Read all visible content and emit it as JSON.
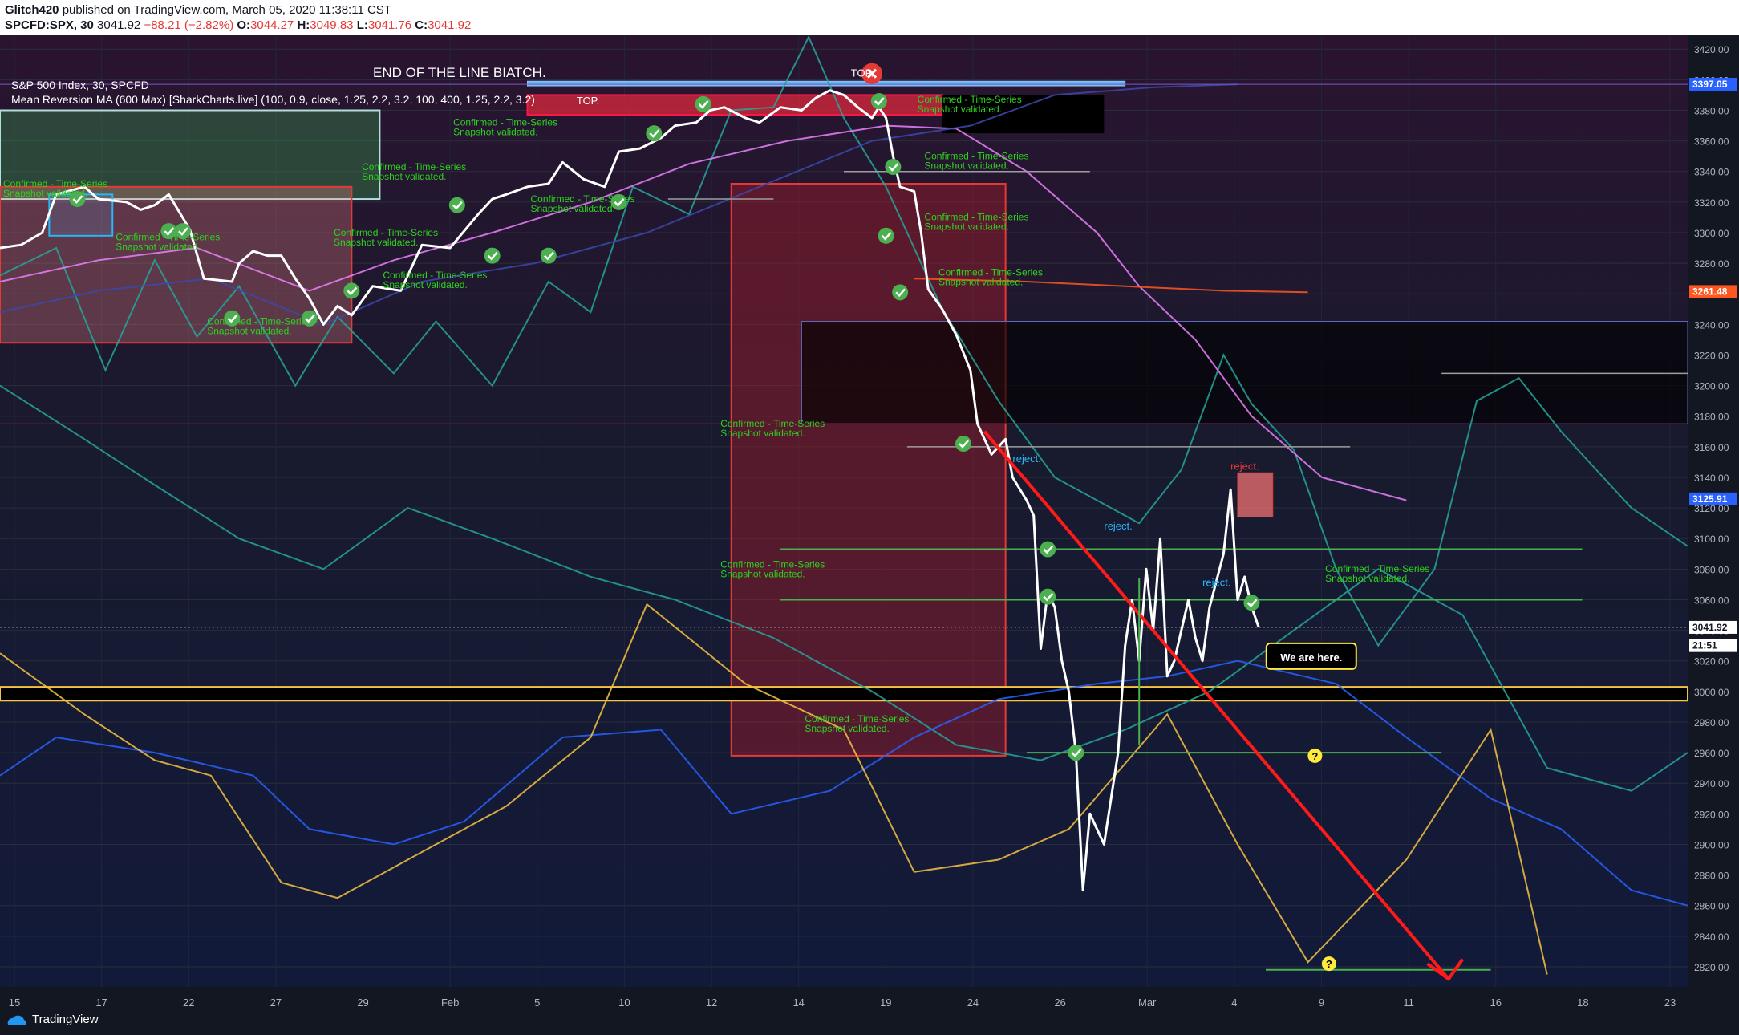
{
  "header": {
    "author": "Glitch420",
    "published_text": "published on TradingView.com, March 05, 2020 11:38:11 CST",
    "symbol": "SPCFD:SPX, 30",
    "last": "3041.92",
    "change": "−88.21 (−2.82%)",
    "open_label": "O:",
    "open": "3044.27",
    "high_label": "H:",
    "high": "3049.83",
    "low_label": "L:",
    "low": "3041.76",
    "close_label": "C:",
    "close": "3041.92"
  },
  "legend": {
    "title": "S&P 500 Index, 30, SPCFD",
    "indicator": "Mean Reversion MA (600 Max) [SharkCharts.live] (100, 0.9, close, 1.25, 2.2, 3.2, 100, 400, 1.25, 2.2, 3.2)"
  },
  "brand": {
    "name": "TradingView"
  },
  "colors": {
    "background": "#131722",
    "price": "#ffffff",
    "teal": "#26a69a",
    "yellow": "#f6c342",
    "blue": "#2962ff",
    "pink": "#ea80fc",
    "orange": "#ff5722",
    "red_zone": "#e53935",
    "green": "#4caf50"
  },
  "chart_data": {
    "type": "line",
    "title": "END OF THE LINE BIATCH.",
    "y_range": [
      2810,
      3428
    ],
    "y_ticks": [
      "3420.00",
      "3400.00",
      "3380.00",
      "3360.00",
      "3340.00",
      "3320.00",
      "3300.00",
      "3280.00",
      "3260.00",
      "3240.00",
      "3220.00",
      "3200.00",
      "3180.00",
      "3160.00",
      "3140.00",
      "3120.00",
      "3100.00",
      "3080.00",
      "3060.00",
      "3040.00",
      "3020.00",
      "3000.00",
      "2980.00",
      "2960.00",
      "2940.00",
      "2920.00",
      "2900.00",
      "2880.00",
      "2860.00",
      "2840.00",
      "2820.00"
    ],
    "x_ticks": [
      "15",
      "17",
      "22",
      "27",
      "29",
      "Feb",
      "5",
      "10",
      "12",
      "14",
      "19",
      "24",
      "26",
      "Mar",
      "4",
      "9",
      "11",
      "16",
      "18",
      "23"
    ],
    "price_badges": [
      {
        "value": "3397.05",
        "color": "#2962ff"
      },
      {
        "value": "3261.48",
        "color": "#ff5722"
      },
      {
        "value": "3125.91",
        "color": "#2962ff"
      },
      {
        "value": "3041.92",
        "color": "#ffffff"
      },
      {
        "value": "21:51",
        "color": "#ffffff"
      }
    ],
    "series": [
      {
        "name": "SPX",
        "color": "#ffffff",
        "values": [
          [
            0,
            3290
          ],
          [
            3,
            3292
          ],
          [
            6,
            3300
          ],
          [
            8,
            3325
          ],
          [
            12,
            3330
          ],
          [
            14,
            3322
          ],
          [
            18,
            3320
          ],
          [
            20,
            3315
          ],
          [
            22,
            3318
          ],
          [
            24,
            3325
          ],
          [
            27,
            3302
          ],
          [
            29,
            3270
          ],
          [
            33,
            3268
          ],
          [
            34,
            3280
          ],
          [
            36,
            3288
          ],
          [
            38,
            3285
          ],
          [
            40,
            3285
          ],
          [
            42,
            3270
          ],
          [
            44,
            3257
          ],
          [
            46,
            3240
          ],
          [
            48,
            3252
          ],
          [
            50,
            3246
          ],
          [
            53,
            3265
          ],
          [
            57,
            3262
          ],
          [
            60,
            3292
          ],
          [
            64,
            3290
          ],
          [
            68,
            3312
          ],
          [
            70,
            3322
          ],
          [
            72,
            3325
          ],
          [
            75,
            3330
          ],
          [
            78,
            3332
          ],
          [
            80,
            3346
          ],
          [
            83,
            3335
          ],
          [
            86,
            3330
          ],
          [
            88,
            3353
          ],
          [
            91,
            3355
          ],
          [
            94,
            3362
          ],
          [
            96,
            3370
          ],
          [
            99,
            3372
          ],
          [
            101,
            3380
          ],
          [
            103,
            3382
          ],
          [
            106,
            3375
          ],
          [
            108,
            3372
          ],
          [
            111,
            3382
          ],
          [
            114,
            3380
          ],
          [
            116,
            3388
          ],
          [
            118,
            3393
          ],
          [
            120,
            3390
          ],
          [
            122,
            3382
          ],
          [
            124,
            3375
          ],
          [
            125,
            3382
          ],
          [
            126,
            3375
          ],
          [
            127,
            3350
          ],
          [
            128,
            3330
          ],
          [
            130,
            3327
          ],
          [
            131,
            3300
          ],
          [
            132,
            3263
          ],
          [
            134,
            3250
          ],
          [
            136,
            3233
          ],
          [
            138,
            3210
          ],
          [
            139,
            3175
          ],
          [
            141,
            3155
          ],
          [
            143,
            3165
          ],
          [
            144,
            3140
          ],
          [
            146,
            3125
          ],
          [
            147,
            3115
          ],
          [
            148,
            3028
          ],
          [
            149,
            3065
          ],
          [
            150,
            3055
          ],
          [
            151,
            3020
          ],
          [
            152,
            3000
          ],
          [
            153,
            2960
          ],
          [
            154,
            2870
          ],
          [
            155,
            2920
          ],
          [
            157,
            2900
          ],
          [
            159,
            2960
          ],
          [
            160,
            3030
          ],
          [
            161,
            3060
          ],
          [
            162,
            3020
          ],
          [
            163,
            3080
          ],
          [
            164,
            3040
          ],
          [
            165,
            3100
          ],
          [
            166,
            3010
          ],
          [
            167,
            3020
          ],
          [
            168,
            3040
          ],
          [
            169,
            3060
          ],
          [
            170,
            3035
          ],
          [
            171,
            3020
          ],
          [
            172,
            3055
          ],
          [
            174,
            3090
          ],
          [
            175,
            3132
          ],
          [
            176,
            3060
          ],
          [
            177,
            3075
          ],
          [
            178,
            3055
          ],
          [
            179,
            3042
          ]
        ]
      },
      {
        "name": "",
        "color": "#26a69a",
        "values": [
          [
            0,
            3272
          ],
          [
            8,
            3290
          ],
          [
            15,
            3210
          ],
          [
            22,
            3282
          ],
          [
            28,
            3232
          ],
          [
            34,
            3265
          ],
          [
            42,
            3200
          ],
          [
            48,
            3245
          ],
          [
            56,
            3208
          ],
          [
            62,
            3242
          ],
          [
            70,
            3200
          ],
          [
            78,
            3268
          ],
          [
            84,
            3248
          ],
          [
            90,
            3330
          ],
          [
            98,
            3312
          ],
          [
            104,
            3380
          ],
          [
            110,
            3382
          ],
          [
            115,
            3428
          ],
          [
            120,
            3375
          ],
          [
            126,
            3330
          ],
          [
            134,
            3250
          ],
          [
            142,
            3190
          ],
          [
            150,
            3140
          ],
          [
            158,
            3120
          ],
          [
            162,
            3110
          ],
          [
            168,
            3145
          ],
          [
            174,
            3220
          ],
          [
            178,
            3188
          ],
          [
            184,
            3158
          ],
          [
            190,
            3080
          ],
          [
            196,
            3030
          ],
          [
            204,
            3080
          ],
          [
            210,
            3190
          ],
          [
            216,
            3205
          ],
          [
            222,
            3170
          ],
          [
            228,
            3140
          ],
          [
            232,
            3120
          ],
          [
            240,
            3095
          ]
        ]
      },
      {
        "name": "",
        "color": "#26a69a",
        "values": [
          [
            0,
            3200
          ],
          [
            12,
            3165
          ],
          [
            22,
            3135
          ],
          [
            34,
            3100
          ],
          [
            46,
            3080
          ],
          [
            58,
            3120
          ],
          [
            70,
            3100
          ],
          [
            84,
            3075
          ],
          [
            96,
            3060
          ],
          [
            110,
            3035
          ],
          [
            124,
            3000
          ],
          [
            136,
            2965
          ],
          [
            148,
            2955
          ],
          [
            160,
            2975
          ],
          [
            172,
            3000
          ],
          [
            184,
            3040
          ],
          [
            196,
            3080
          ],
          [
            208,
            3050
          ],
          [
            220,
            2950
          ],
          [
            232,
            2935
          ],
          [
            240,
            2960
          ]
        ]
      },
      {
        "name": "",
        "color": "#2962ff",
        "values": [
          [
            0,
            2945
          ],
          [
            8,
            2970
          ],
          [
            22,
            2960
          ],
          [
            36,
            2945
          ],
          [
            44,
            2910
          ],
          [
            56,
            2900
          ],
          [
            66,
            2915
          ],
          [
            80,
            2970
          ],
          [
            94,
            2975
          ],
          [
            104,
            2920
          ],
          [
            118,
            2935
          ],
          [
            130,
            2970
          ],
          [
            142,
            2995
          ],
          [
            156,
            3005
          ],
          [
            166,
            3010
          ],
          [
            176,
            3020
          ],
          [
            190,
            3005
          ],
          [
            200,
            2970
          ],
          [
            212,
            2930
          ],
          [
            222,
            2910
          ],
          [
            232,
            2870
          ],
          [
            240,
            2860
          ]
        ]
      },
      {
        "name": "",
        "color": "#f6c342",
        "values": [
          [
            0,
            3025
          ],
          [
            12,
            2985
          ],
          [
            22,
            2955
          ],
          [
            30,
            2945
          ],
          [
            40,
            2875
          ],
          [
            48,
            2865
          ],
          [
            58,
            2890
          ],
          [
            72,
            2925
          ],
          [
            84,
            2970
          ],
          [
            92,
            3057
          ],
          [
            106,
            3005
          ],
          [
            120,
            2975
          ],
          [
            130,
            2882
          ],
          [
            142,
            2890
          ],
          [
            152,
            2910
          ],
          [
            166,
            2985
          ],
          [
            176,
            2900
          ],
          [
            186,
            2823
          ],
          [
            200,
            2890
          ],
          [
            212,
            2975
          ],
          [
            220,
            2815
          ]
        ]
      },
      {
        "name": "",
        "color": "#ea80fc",
        "values": [
          [
            0,
            3268
          ],
          [
            14,
            3282
          ],
          [
            28,
            3290
          ],
          [
            44,
            3262
          ],
          [
            56,
            3282
          ],
          [
            70,
            3300
          ],
          [
            84,
            3320
          ],
          [
            98,
            3345
          ],
          [
            112,
            3360
          ],
          [
            126,
            3370
          ],
          [
            136,
            3368
          ],
          [
            146,
            3340
          ],
          [
            156,
            3300
          ],
          [
            162,
            3265
          ],
          [
            170,
            3230
          ],
          [
            178,
            3180
          ],
          [
            188,
            3140
          ],
          [
            200,
            3125
          ]
        ]
      },
      {
        "name": "",
        "color": "#ff5722",
        "values": [
          [
            130,
            3270
          ],
          [
            146,
            3268
          ],
          [
            160,
            3265
          ],
          [
            174,
            3262
          ],
          [
            186,
            3261
          ]
        ]
      },
      {
        "name": "",
        "color": "#3949ab",
        "values": [
          [
            0,
            3248
          ],
          [
            14,
            3262
          ],
          [
            30,
            3270
          ],
          [
            46,
            3240
          ],
          [
            60,
            3268
          ],
          [
            76,
            3280
          ],
          [
            92,
            3300
          ],
          [
            108,
            3330
          ],
          [
            124,
            3360
          ],
          [
            138,
            3370
          ],
          [
            150,
            3390
          ],
          [
            164,
            3395
          ],
          [
            176,
            3397
          ]
        ]
      }
    ],
    "annotations": [
      {
        "text": "TOP.",
        "x": 121,
        "y": 3402,
        "color": "#ffffff"
      },
      {
        "text": "TOP.",
        "x": 82,
        "y": 3384,
        "color": "#ffffff"
      },
      {
        "text": "reject.",
        "x": 144,
        "y": 3150,
        "color": "#29b6f6"
      },
      {
        "text": "reject.",
        "x": 157,
        "y": 3106,
        "color": "#29b6f6"
      },
      {
        "text": "reject.",
        "x": 175,
        "y": 3145,
        "color": "#e53935"
      },
      {
        "text": "reject.",
        "x": 171,
        "y": 3069,
        "color": "#29b6f6"
      },
      {
        "text": "We are here.",
        "x": 181,
        "y": 3022,
        "color": "#ffffff"
      }
    ],
    "validated_labels": [
      {
        "text": "Confirmed - Time-Series Snapshot validated.",
        "x": 64,
        "y": 3370
      },
      {
        "text": "Confirmed - Time-Series Snapshot validated.",
        "x": 51,
        "y": 3341
      },
      {
        "text": "Confirmed - Time-Series Snapshot validated.",
        "x": 75,
        "y": 3320
      },
      {
        "text": "Confirmed - Time-Series Snapshot validated.",
        "x": 0,
        "y": 3330
      },
      {
        "text": "Confirmed - Time-Series Snapshot validated.",
        "x": 16,
        "y": 3295
      },
      {
        "text": "Confirmed - Time-Series Snapshot validated.",
        "x": 47,
        "y": 3298
      },
      {
        "text": "Confirmed - Time-Series Snapshot validated.",
        "x": 54,
        "y": 3270
      },
      {
        "text": "Confirmed - Time-Series Snapshot validated.",
        "x": 29,
        "y": 3240
      },
      {
        "text": "Confirmed - Time-Series Snapshot validated.",
        "x": 130,
        "y": 3385
      },
      {
        "text": "Confirmed - Time-Series Snapshot validated.",
        "x": 131,
        "y": 3348
      },
      {
        "text": "Confirmed - Time-Series Snapshot validated.",
        "x": 131,
        "y": 3308
      },
      {
        "text": "Confirmed - Time-Series Snapshot validated.",
        "x": 133,
        "y": 3272
      },
      {
        "text": "Confirmed - Time-Series Snapshot validated.",
        "x": 102,
        "y": 3173
      },
      {
        "text": "Confirmed - Time-Series Snapshot validated.",
        "x": 102,
        "y": 3081
      },
      {
        "text": "Confirmed - Time-Series Snapshot validated.",
        "x": 114,
        "y": 2980
      },
      {
        "text": "Confirmed - Time-Series Snapshot validated.",
        "x": 188,
        "y": 3078
      }
    ]
  }
}
